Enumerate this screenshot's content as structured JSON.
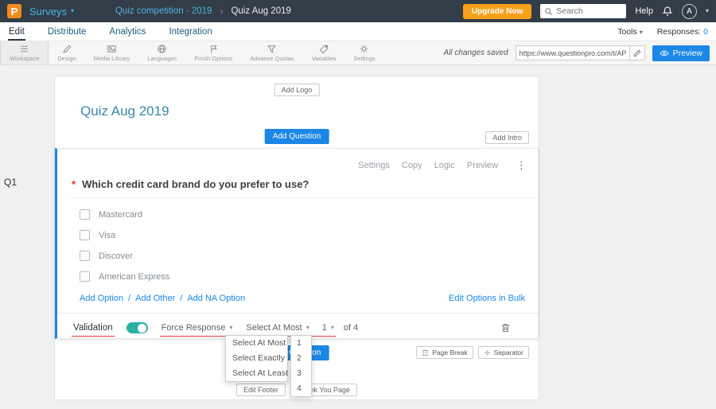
{
  "icons": {
    "caret": "▾",
    "ellipsis": "⋮",
    "breadcrumb_separator": "›",
    "slash": "/",
    "required_marker": "*"
  },
  "topbar": {
    "logo_letter": "P",
    "surveys_label": "Surveys",
    "breadcrumb": {
      "parent": "Quiz competition - 2019",
      "current": "Quiz Aug 2019"
    },
    "upgrade_label": "Upgrade Now",
    "search_placeholder": "Search",
    "help_label": "Help",
    "avatar_initial": "A"
  },
  "nav": {
    "tabs": [
      {
        "label": "Edit"
      },
      {
        "label": "Distribute"
      },
      {
        "label": "Analytics"
      },
      {
        "label": "Integration"
      }
    ],
    "tools_label": "Tools",
    "responses_label": "Responses:",
    "responses_count": "0"
  },
  "toolbar": {
    "items": [
      {
        "label": "Workspace"
      },
      {
        "label": "Design"
      },
      {
        "label": "Media Library"
      },
      {
        "label": "Languages"
      },
      {
        "label": "Finish Options"
      },
      {
        "label": "Advance Quotas"
      },
      {
        "label": "Variables"
      },
      {
        "label": "Settings"
      }
    ],
    "saved_text": "All changes saved",
    "url_value": "https://www.questionpro.com/t/APNrFZ",
    "preview_label": "Preview"
  },
  "page": {
    "add_logo_label": "Add Logo",
    "title": "Quiz Aug 2019",
    "add_question_label": "Add Question",
    "add_intro_label": "Add Intro",
    "question": {
      "qid": "Q1",
      "text": "Which credit card brand do you prefer to use?",
      "actions": [
        {
          "label": "Settings"
        },
        {
          "label": "Copy"
        },
        {
          "label": "Logic"
        },
        {
          "label": "Preview"
        }
      ],
      "options": [
        {
          "label": "Mastercard"
        },
        {
          "label": "Visa"
        },
        {
          "label": "Discover"
        },
        {
          "label": "American Express"
        }
      ],
      "links": [
        {
          "label": "Add Option"
        },
        {
          "label": "Add Other"
        },
        {
          "label": "Add NA Option"
        }
      ],
      "bulk_label": "Edit Options in Bulk",
      "validation_label": "Validation",
      "force_response_label": "Force Response",
      "select_rule_label": "Select At Most",
      "count_value": "1",
      "of_label": "of 4"
    },
    "rule_menu": {
      "options": [
        {
          "label": "Select At Most"
        },
        {
          "label": "Select Exactly"
        },
        {
          "label": "Select At Least"
        }
      ]
    },
    "count_menu": {
      "options": [
        {
          "label": "1"
        },
        {
          "label": "2"
        },
        {
          "label": "3"
        },
        {
          "label": "4"
        }
      ]
    },
    "page_break_label": "Page Break",
    "separator_label": "Separator",
    "edit_footer_label": "Edit Footer",
    "thank_you_label": "Thank You Page"
  }
}
